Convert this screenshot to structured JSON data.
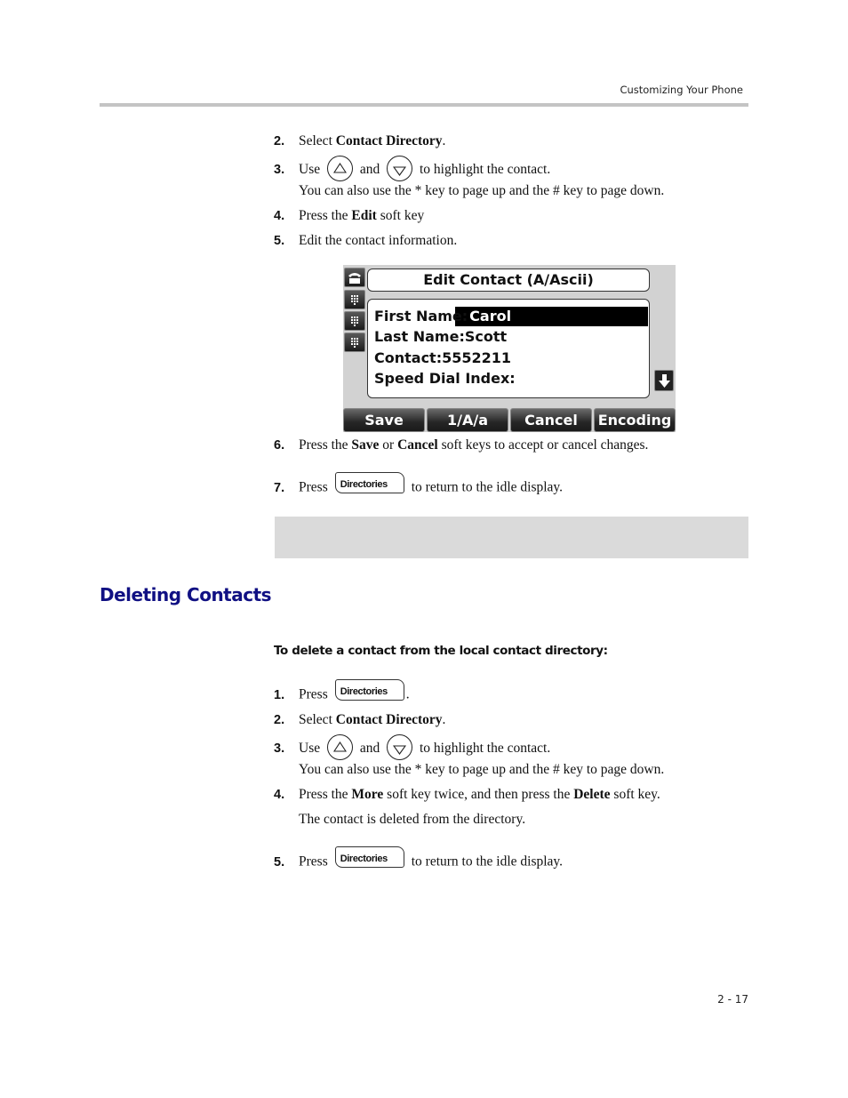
{
  "header": {
    "title": "Customizing Your Phone"
  },
  "steps_edit": [
    {
      "num": "2.",
      "pre": "Select ",
      "bold": "Contact Directory",
      "post": "."
    },
    {
      "num": "3.",
      "pre": "Use",
      "mid": "and",
      "post": "to highlight the contact.",
      "note": "You can also use the * key to page up and the # key to page down."
    },
    {
      "num": "4.",
      "pre": "Press the ",
      "bold": "Edit",
      "post": " soft key"
    },
    {
      "num": "5.",
      "text": "Edit the contact information."
    },
    {
      "num": "6.",
      "pre": "Press the ",
      "bold": "Save",
      "mid": " or ",
      "bold2": "Cancel",
      "post": " soft keys to accept or cancel changes."
    },
    {
      "num": "7.",
      "pre": "Press",
      "post": "to return to the idle display."
    }
  ],
  "directories_key": {
    "label": "Directories"
  },
  "icons": {
    "up": "up-arrow-nav-key-icon",
    "down": "down-arrow-nav-key-icon"
  },
  "phone_screen": {
    "title": "Edit Contact (A/Ascii)",
    "fields": [
      {
        "label": "First Name:",
        "value": "Carol"
      },
      {
        "label": "Last Name:",
        "value": "Scott"
      },
      {
        "label": "Contact:",
        "value": "5552211"
      },
      {
        "label": "Speed Dial Index:",
        "value": ""
      }
    ],
    "softkeys": [
      "Save",
      "1/A/a",
      "Cancel",
      "Encoding"
    ]
  },
  "section": {
    "heading": "Deleting Contacts",
    "procedure_heading": "To delete a contact from the local contact directory:"
  },
  "steps_delete": [
    {
      "num": "1.",
      "pre": "Press",
      "post": "."
    },
    {
      "num": "2.",
      "pre": "Select ",
      "bold": "Contact Directory",
      "post": "."
    },
    {
      "num": "3.",
      "pre": "Use",
      "mid": "and",
      "post": "to highlight the contact.",
      "note": "You can also use the * key to page up and the # key to page down."
    },
    {
      "num": "4.",
      "pre": "Press the ",
      "bold": "More",
      "mid": " soft key twice, and then press the ",
      "bold2": "Delete",
      "post": " soft key.",
      "note": "The contact is deleted from the directory."
    },
    {
      "num": "5.",
      "pre": "Press",
      "post": "to return to the idle display."
    }
  ],
  "footer": {
    "page_number": "2 - 17"
  }
}
